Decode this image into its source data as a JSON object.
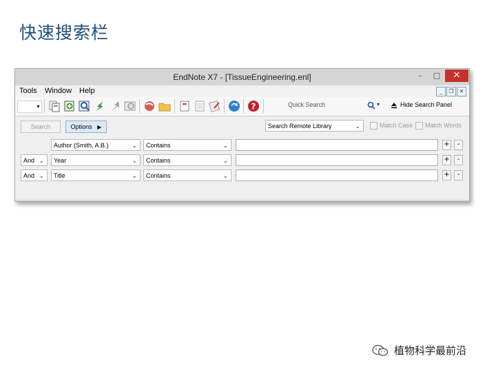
{
  "slide": {
    "title": "快速搜索栏"
  },
  "window": {
    "title": "EndNote X7 - [TissueEngineering.enl]",
    "controls": {
      "minimize": "–",
      "maximize": "□",
      "close": "✕"
    }
  },
  "menu": {
    "items": [
      {
        "label": "Tools"
      },
      {
        "label": "Window"
      },
      {
        "label": "Help"
      }
    ],
    "mdi": {
      "minimize": "_",
      "restore": "❐",
      "close": "✕"
    }
  },
  "toolbar": {
    "quick_search_placeholder": "Quick Search",
    "hide_search_panel": "Hide Search Panel",
    "icons": [
      "copy-icon",
      "new-reference-icon",
      "find-full-text-icon",
      "import-icon",
      "export-icon",
      "online-search-icon",
      "integrated-library-icon",
      "open-folder-icon",
      "insert-citation-icon",
      "format-bibliography-icon",
      "cite-while-you-write-icon",
      "sync-icon",
      "help-icon"
    ]
  },
  "search_panel": {
    "search_button": "Search",
    "options_button": "Options",
    "remote_library": "Search Remote Library",
    "match_case": "Match Case",
    "match_words": "Match Words",
    "rows": [
      {
        "bool": "",
        "field": "Author (Smith, A.B.)",
        "op": "Contains",
        "value": ""
      },
      {
        "bool": "And",
        "field": "Year",
        "op": "Contains",
        "value": ""
      },
      {
        "bool": "And",
        "field": "Title",
        "op": "Contains",
        "value": ""
      }
    ]
  },
  "watermark": {
    "text": "植物科学最前沿"
  }
}
